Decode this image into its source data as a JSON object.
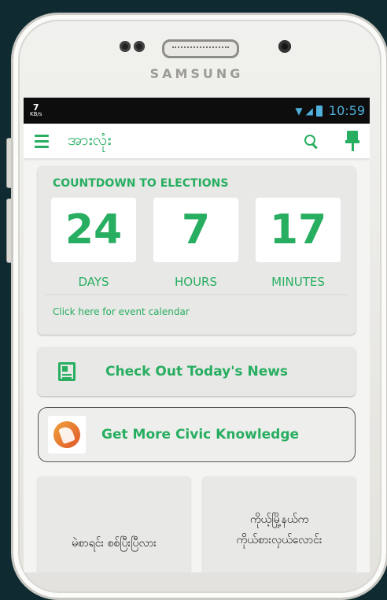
{
  "device": {
    "brand": "SAMSUNG"
  },
  "status_bar": {
    "speed_value": "7",
    "speed_unit": "KB/s",
    "time": "10:59"
  },
  "app_bar": {
    "title": "အားလုံး"
  },
  "countdown": {
    "title": "COUNTDOWN TO ELECTIONS",
    "units": [
      {
        "value": "24",
        "label": "DAYS"
      },
      {
        "value": "7",
        "label": "HOURS"
      },
      {
        "value": "17",
        "label": "MINUTES"
      }
    ],
    "link": "Click here for event calendar"
  },
  "news_card": {
    "label": "Check Out Today's News"
  },
  "civic_card": {
    "label": "Get More Civic Knowledge"
  },
  "tiles": [
    {
      "line1": "မဲစာရင်း စစ်ပြီးပြီလား"
    },
    {
      "line1": "ကိုယ့်မြို့နယ်က",
      "line2": "ကိုယ်စားလှယ်လောင်း"
    }
  ],
  "colors": {
    "accent": "#27ae60",
    "status_blue": "#4fb0dc"
  }
}
